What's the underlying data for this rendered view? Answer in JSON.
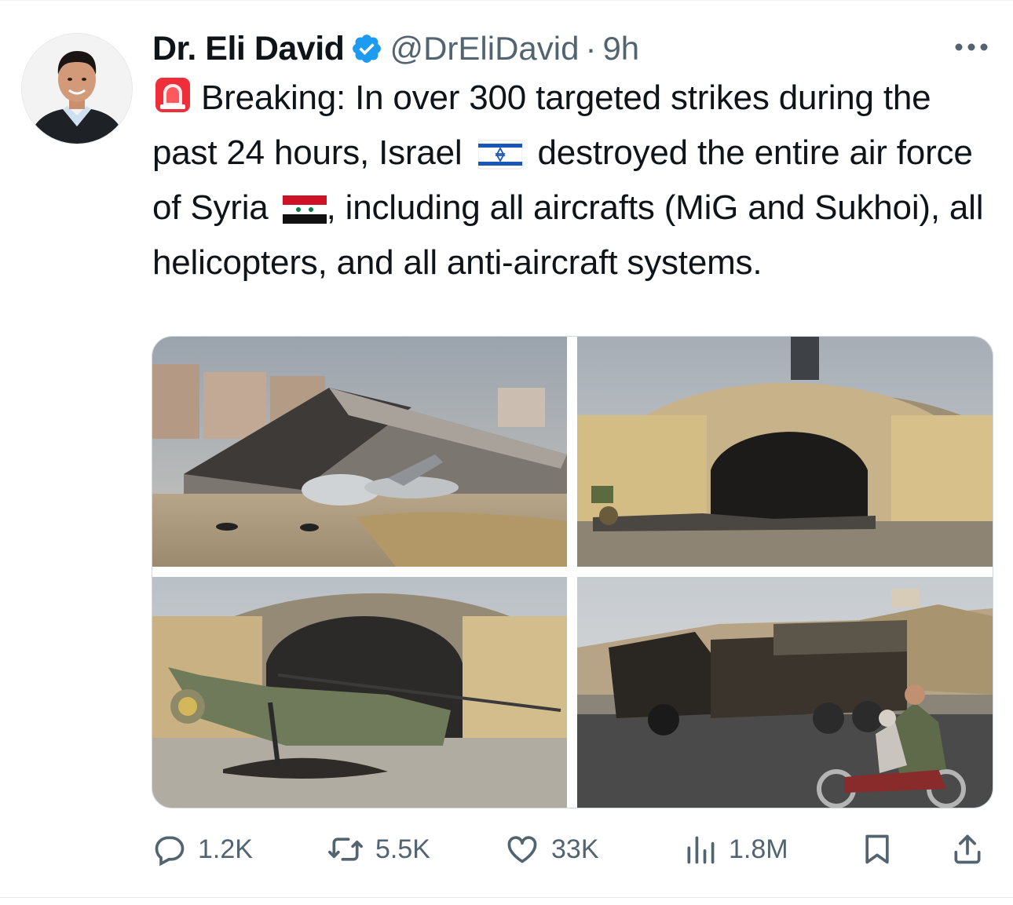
{
  "tweet": {
    "author_name": "Dr. Eli David",
    "handle": "@DrEliDavid",
    "separator": "·",
    "time": "9h",
    "text_main": "Breaking: In over 300 targeted strikes during the past 24 hours, Israel",
    "text_after_israel": " destroyed the entire air force of Syria",
    "text_after_syria": ", including all aircrafts (MiG and Sukhoi), all helicopters, and all anti-aircraft systems.",
    "emojis": [
      "siren-emoji",
      "israel-flag-emoji",
      "syria-flag-emoji"
    ],
    "verified": true
  },
  "media": {
    "photos": [
      {
        "subject": "collapsed hangar with destroyed jet"
      },
      {
        "subject": "hardened aircraft shelter with wreckage"
      },
      {
        "subject": "shelter with destroyed helicopter"
      },
      {
        "subject": "burned anti-aircraft truck and motorbike riders"
      }
    ]
  },
  "actions": {
    "replies": "1.2K",
    "reposts": "5.5K",
    "likes": "33K",
    "views": "1.8M"
  },
  "icons": [
    "verified-badge-icon",
    "more-icon",
    "reply-icon",
    "repost-icon",
    "like-icon",
    "views-icon",
    "bookmark-icon",
    "share-icon"
  ],
  "colors": {
    "text": "#0f1419",
    "secondary": "#536471",
    "verified": "#1d9bf0",
    "border": "#cfd9de"
  }
}
